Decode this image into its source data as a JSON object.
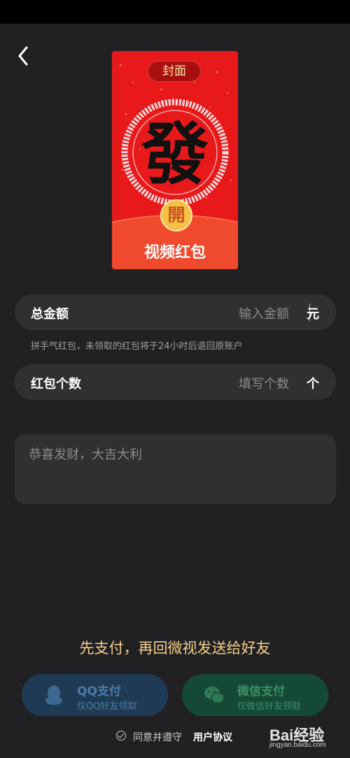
{
  "envelope": {
    "cover_tag": "封面",
    "main_glyph": "發",
    "open_button": "開",
    "title": "视频红包"
  },
  "total_amount": {
    "label": "总金额",
    "placeholder": "输入金额",
    "unit": "元"
  },
  "hint": "拼手气红包，未领取的红包将于24小时后退回原账户",
  "packet_count": {
    "label": "红包个数",
    "placeholder": "填写个数",
    "unit": "个"
  },
  "message": {
    "placeholder": "恭喜发财，大吉大利"
  },
  "promo_text": "先支付，再回微视发送给好友",
  "payment": {
    "qq": {
      "title": "QQ支付",
      "subtitle": "仅QQ好友领取",
      "icon": "qq-penguin-icon"
    },
    "wechat": {
      "title": "微信支付",
      "subtitle": "仅微信好友领取",
      "icon": "wechat-icon"
    }
  },
  "agreement": {
    "text": "同意并遵守",
    "link": "用户协议"
  },
  "watermark": {
    "brand": "Bai经验",
    "sub": "jingyan.baidu.com"
  },
  "colors": {
    "background": "#212124",
    "envelope_red": "#e8191b",
    "promo_gold": "#f5cf8a"
  }
}
